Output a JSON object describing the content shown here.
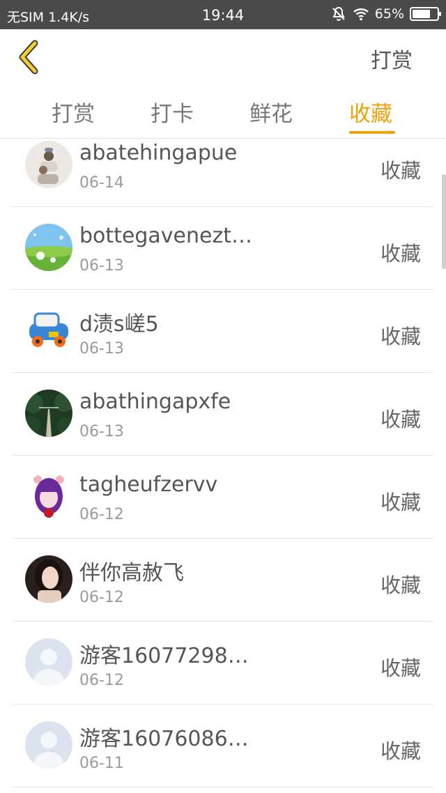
{
  "status_bar": {
    "carrier": "无SIM 1.4K/s",
    "time": "19:44",
    "battery": "65%"
  },
  "header": {
    "action_label": "打赏"
  },
  "tabs": [
    {
      "label": "打赏"
    },
    {
      "label": "打卡"
    },
    {
      "label": "鲜花"
    },
    {
      "label": "收藏"
    }
  ],
  "active_tab": "收藏",
  "list": [
    {
      "name": "abatehingapue",
      "date": "06-14",
      "action": "收藏",
      "avatar": "photo-people"
    },
    {
      "name": "bottegavenezt…",
      "date": "06-13",
      "action": "收藏",
      "avatar": "meadow-dandelion"
    },
    {
      "name": "d渍s嵯5",
      "date": "06-13",
      "action": "收藏",
      "avatar": "toy-car"
    },
    {
      "name": "abathingapxfe",
      "date": "06-13",
      "action": "收藏",
      "avatar": "forest-road"
    },
    {
      "name": "tagheufzervv",
      "date": "06-12",
      "action": "收藏",
      "avatar": "anime-girl"
    },
    {
      "name": "伴你高赦飞",
      "date": "06-12",
      "action": "收藏",
      "avatar": "woman-photo"
    },
    {
      "name": "游客16077298…",
      "date": "06-12",
      "action": "收藏",
      "avatar": "default-user"
    },
    {
      "name": "游客16076086…",
      "date": "06-11",
      "action": "收藏",
      "avatar": "default-user"
    }
  ],
  "colors": {
    "accent": "#f0a20d",
    "status_bar_bg": "#4a4a4a",
    "text_primary": "#555555",
    "text_secondary": "#9a9a9a"
  }
}
